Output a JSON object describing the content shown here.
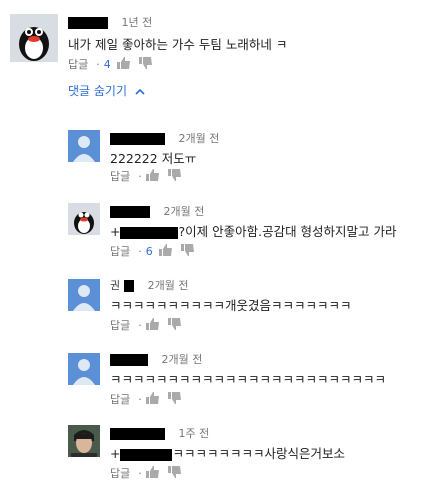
{
  "top_comment": {
    "time": "1년 전",
    "text": "내가 제일 좋아하는 가수 두팀 노래하네 ㅋ",
    "reply_label": "답글",
    "like_count": "4"
  },
  "toggle": {
    "label": "댓글 숨기기",
    "icon": "chevron-up-icon"
  },
  "replies": [
    {
      "name": "",
      "time": "2개월 전",
      "text": "222222 저도ㅠ",
      "reply_label": "답글",
      "like_count": "",
      "avatar": "default"
    },
    {
      "name": "",
      "time": "2개월 전",
      "text_prefix": "+",
      "text": "?이제 안좋아함.공감대 형성하지말고 가라",
      "reply_label": "답글",
      "like_count": "6",
      "avatar": "penguin"
    },
    {
      "name": "권",
      "time": "2개월 전",
      "text": "ㅋㅋㅋㅋㅋㅋㅋㅋㅋㅋ개웃겼음ㅋㅋㅋㅋㅋㅋㅋ",
      "reply_label": "답글",
      "like_count": "",
      "avatar": "default"
    },
    {
      "name": "",
      "time": "2개월 전",
      "text": "ㅋㅋㅋㅋㅋㅋㅋㅋㅋㅋㅋㅋㅋㅋㅋㅋㅋㅋㅋㅋㅋㅋㅋㅋ",
      "reply_label": "답글",
      "like_count": "",
      "avatar": "default"
    },
    {
      "name": "",
      "time": "1주 전",
      "text_prefix": "+",
      "text": "ㅋㅋㅋㅋㅋㅋㅋㅋ사랑식은거보소",
      "reply_label": "답글",
      "like_count": "",
      "avatar": "photo"
    }
  ]
}
